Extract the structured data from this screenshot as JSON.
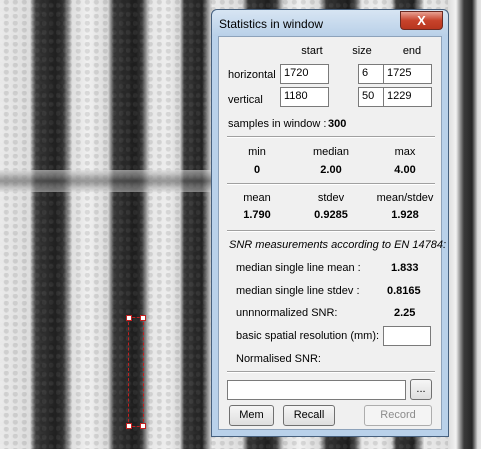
{
  "window": {
    "title": "Statistics in window",
    "close_glyph": "X"
  },
  "window_params": {
    "col_start": "start",
    "col_size": "size",
    "col_end": "end",
    "horizontal_label": "horizontal",
    "vertical_label": "vertical",
    "h_start": "1720",
    "h_size": "6",
    "h_end": "1725",
    "v_start": "1180",
    "v_size": "50",
    "v_end": "1229"
  },
  "samples": {
    "label": "samples in window :",
    "value": "300"
  },
  "stats1": {
    "min_label": "min",
    "min_value": "0",
    "median_label": "median",
    "median_value": "2.00",
    "max_label": "max",
    "max_value": "4.00"
  },
  "stats2": {
    "mean_label": "mean",
    "mean_value": "1.790",
    "stdev_label": "stdev",
    "stdev_value": "0.9285",
    "ratio_label": "mean/stdev",
    "ratio_value": "1.928"
  },
  "snr": {
    "heading": "SNR measurements according to EN 14784:",
    "median_mean_label": "median single line mean :",
    "median_mean_value": "1.833",
    "median_stdev_label": "median single line stdev :",
    "median_stdev_value": "0.8165",
    "unnorm_label": "unnnormalized SNR:",
    "unnorm_value": "2.25",
    "resolution_label": "basic spatial resolution (mm):",
    "resolution_value": "",
    "normalised_label": "Normalised SNR:",
    "normalised_value": ""
  },
  "bottom": {
    "path_value": "",
    "browse_label": "...",
    "mem_label": "Mem",
    "recall_label": "Recall",
    "record_label": "Record"
  }
}
